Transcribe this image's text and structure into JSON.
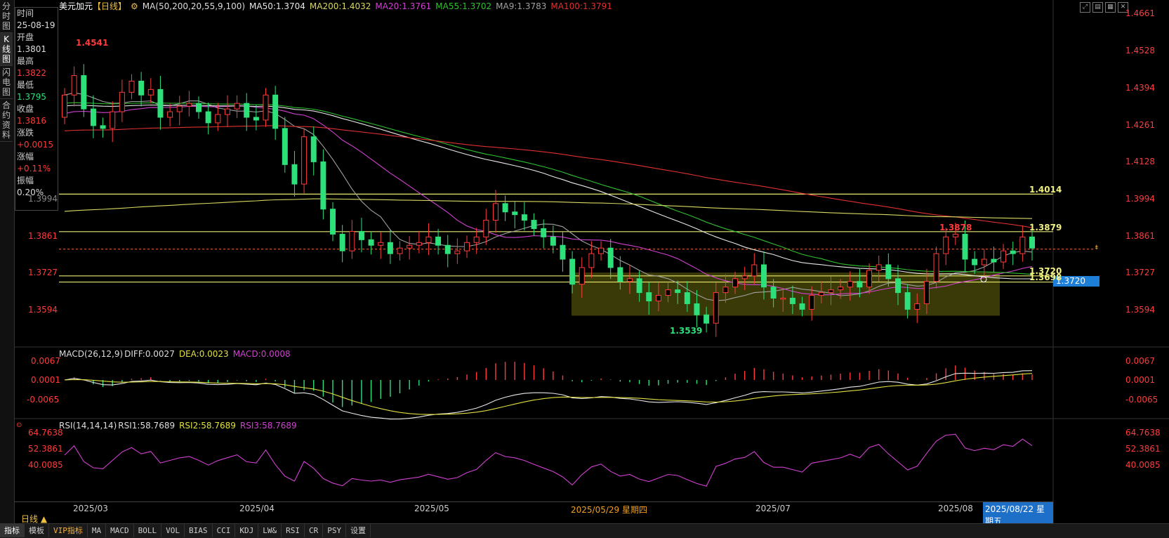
{
  "left_tabs": [
    "分时图",
    "K线图",
    "闪电图",
    "合约资料"
  ],
  "info": {
    "time_label": "时间",
    "time_value": "25-08-19",
    "open_label": "开盘",
    "open_value": "1.3801",
    "high_label": "最高",
    "high_value": "1.3822",
    "low_label": "最低",
    "low_value": "1.3795",
    "close_label": "收盘",
    "close_value": "1.3816",
    "change_label": "涨跌",
    "change_value": "+0.0015",
    "pct_label": "涨幅",
    "pct_value": "+0.11%",
    "amp_label": "振幅",
    "amp_value": "0.20%"
  },
  "header": {
    "symbol": "美元加元",
    "period": "【日线】",
    "settings_icon": "gear-icon",
    "ma_params": "MA(50,200,20,55,9,100)",
    "ma50": "MA50:1.3704",
    "ma200": "MA200:1.4032",
    "ma20": "MA20:1.3761",
    "ma55": "MA55:1.3702",
    "ma9": "MA9:1.3783",
    "ma100": "MA100:1.3791"
  },
  "price_axis": {
    "right": [
      "1.4661",
      "1.4528",
      "1.4394",
      "1.4261",
      "1.4128",
      "1.3994",
      "1.3861",
      "1.3727",
      "1.3594"
    ],
    "left": [
      "1.3994",
      "1.3861",
      "1.3727",
      "1.3594"
    ],
    "current_price": "1.3720"
  },
  "annotations": {
    "high_mark": "1.4541",
    "low_mark": "1.3539",
    "recent_high": "1.3878",
    "line_1": "1.4014",
    "line_2": "1.3879",
    "line_3": "1.3720",
    "line_4": "1.3698"
  },
  "macd": {
    "params": "MACD(26,12,9)",
    "diff": "DIFF:0.0027",
    "dea": "DEA:0.0023",
    "macd": "MACD:0.0008",
    "axis": [
      "0.0067",
      "0.0001",
      "-0.0065"
    ]
  },
  "rsi": {
    "params": "RSI(14,14,14)",
    "rsi1": "RSI1:58.7689",
    "rsi2": "RSI2:58.7689",
    "rsi3": "RSI3:58.7689",
    "axis": [
      "64.7638",
      "52.3861",
      "40.0085"
    ]
  },
  "x_axis": [
    "2025/03",
    "2025/04",
    "2025/05",
    "2025/05/29 星期四",
    "2025/07",
    "2025/08",
    "2025/08/22 星期五"
  ],
  "period_selector": "日线 ▲",
  "bottom_tabs": [
    "指标",
    "模板",
    "VIP指标",
    "MA",
    "MACD",
    "BOLL",
    "VOL",
    "BIAS",
    "CCI",
    "KDJ",
    "LW&",
    "RSI",
    "CR",
    "PSY",
    "设置"
  ],
  "colors": {
    "up": "#ff3b3b",
    "down": "#2ee07a",
    "ma50": "#e8e8e8",
    "ma200": "#d8d860",
    "ma20": "#d040d0",
    "ma55": "#30c030",
    "ma9": "#a0a0a0",
    "ma100": "#e03030",
    "hline": "#e8e870",
    "box": "#6a6a10"
  },
  "chart_data": {
    "type": "candlestick",
    "instrument": "USD/CAD daily",
    "x_range": [
      "2025-02-25",
      "2025-08-22"
    ],
    "ylim": [
      1.35,
      1.4661
    ],
    "key_levels": {
      "high": 1.4541,
      "low": 1.3539,
      "recent_high": 1.3878,
      "h1": 1.4014,
      "h2": 1.3879,
      "h3": 1.372,
      "h4": 1.3698
    },
    "closes": [
      1.437,
      1.444,
      1.432,
      1.426,
      1.425,
      1.431,
      1.438,
      1.442,
      1.437,
      1.439,
      1.429,
      1.431,
      1.433,
      1.434,
      1.431,
      1.427,
      1.43,
      1.432,
      1.434,
      1.429,
      1.428,
      1.437,
      1.425,
      1.412,
      1.405,
      1.422,
      1.413,
      1.396,
      1.387,
      1.381,
      1.388,
      1.385,
      1.383,
      1.384,
      1.38,
      1.382,
      1.383,
      1.384,
      1.386,
      1.383,
      1.38,
      1.381,
      1.384,
      1.386,
      1.392,
      1.398,
      1.395,
      1.394,
      1.392,
      1.389,
      1.386,
      1.383,
      1.378,
      1.369,
      1.375,
      1.38,
      1.382,
      1.375,
      1.37,
      1.371,
      1.366,
      1.363,
      1.365,
      1.367,
      1.366,
      1.362,
      1.358,
      1.355,
      1.366,
      1.368,
      1.371,
      1.372,
      1.376,
      1.368,
      1.364,
      1.364,
      1.362,
      1.36,
      1.365,
      1.366,
      1.367,
      1.368,
      1.37,
      1.368,
      1.374,
      1.376,
      1.371,
      1.366,
      1.36,
      1.362,
      1.37,
      1.38,
      1.386,
      1.387,
      1.378,
      1.376,
      1.378,
      1.377,
      1.381,
      1.38,
      1.386,
      1.382
    ]
  }
}
